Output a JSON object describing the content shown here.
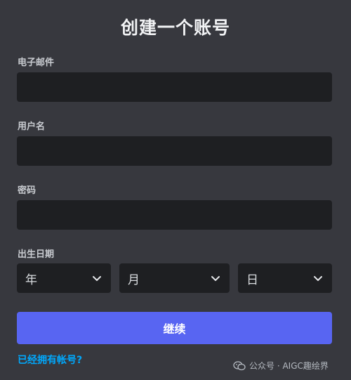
{
  "form": {
    "title": "创建一个账号",
    "email_label": "电子邮件",
    "email_value": "",
    "username_label": "用户名",
    "username_value": "",
    "password_label": "密码",
    "password_value": "",
    "dob_label": "出生日期",
    "year_placeholder": "年",
    "month_placeholder": "月",
    "day_placeholder": "日",
    "continue_label": "继续",
    "login_link": "已经拥有帐号?"
  },
  "watermark": {
    "text": "公众号 · AIGC趣绘界",
    "icon": "wechat-icon"
  },
  "colors": {
    "background": "#37383e",
    "input_background": "#1e1f22",
    "primary_button": "#5865f2",
    "link": "#00a8fc"
  },
  "icons": {
    "dropdown": "chevron-down-icon"
  }
}
